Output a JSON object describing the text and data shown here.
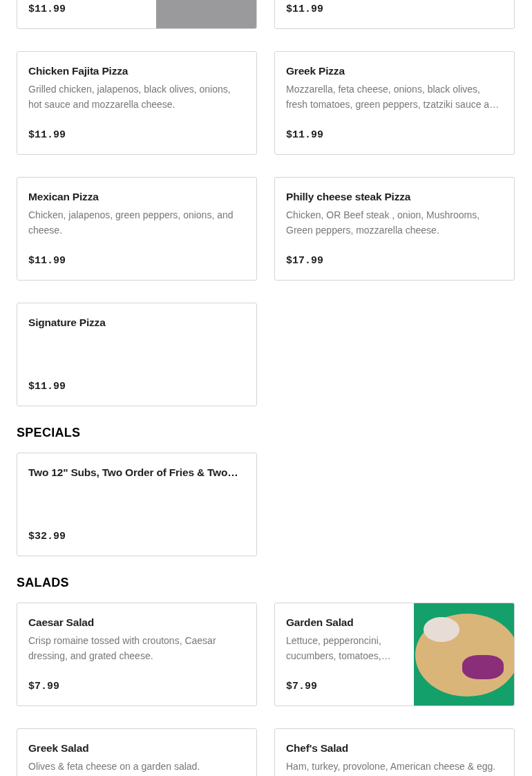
{
  "sections": [
    {
      "items": [
        {
          "kind": "pizza",
          "price": "$11.99"
        },
        {
          "kind": "plain",
          "price": "$11.99"
        },
        {
          "name": "Chicken Fajita Pizza",
          "description": "Grilled chicken, jalapenos, black olives, onions, hot sauce and mozzarella cheese.",
          "price": "$11.99"
        },
        {
          "name": "Greek Pizza",
          "description": "Mozzarella, feta cheese, onions, black olives, fresh tomatoes, green peppers, tzatziki sauce a…",
          "price": "$11.99"
        },
        {
          "name": "Mexican Pizza",
          "description": "Chicken, jalapenos, green peppers, onions, and cheese.",
          "price": "$11.99"
        },
        {
          "name": "Philly cheese steak Pizza",
          "description": "Chicken, OR Beef steak , onion, Mushrooms, Green peppers, mozzarella cheese.",
          "price": "$17.99"
        },
        {
          "name": "Signature Pizza",
          "price": "$11.99"
        }
      ]
    },
    {
      "heading": "SPECIALS",
      "items": [
        {
          "name": "Two 12\" Subs, Two Order of Fries & Two…",
          "price": "$32.99"
        }
      ]
    },
    {
      "heading": "SALADS",
      "items": [
        {
          "name": "Caesar Salad",
          "description": "Crisp romaine tossed with croutons, Caesar dressing, and grated cheese.",
          "price": "$7.99"
        },
        {
          "name": "Garden Salad",
          "description": "Lettuce, pepperoncini, cucumbers, tomatoes,…",
          "price": "$7.99",
          "kind": "salad"
        },
        {
          "name": "Greek Salad",
          "description": "Olives & feta cheese on a garden salad."
        },
        {
          "name": "Chef's Salad",
          "description": "Ham, turkey, provolone, American cheese & egg."
        }
      ]
    }
  ]
}
